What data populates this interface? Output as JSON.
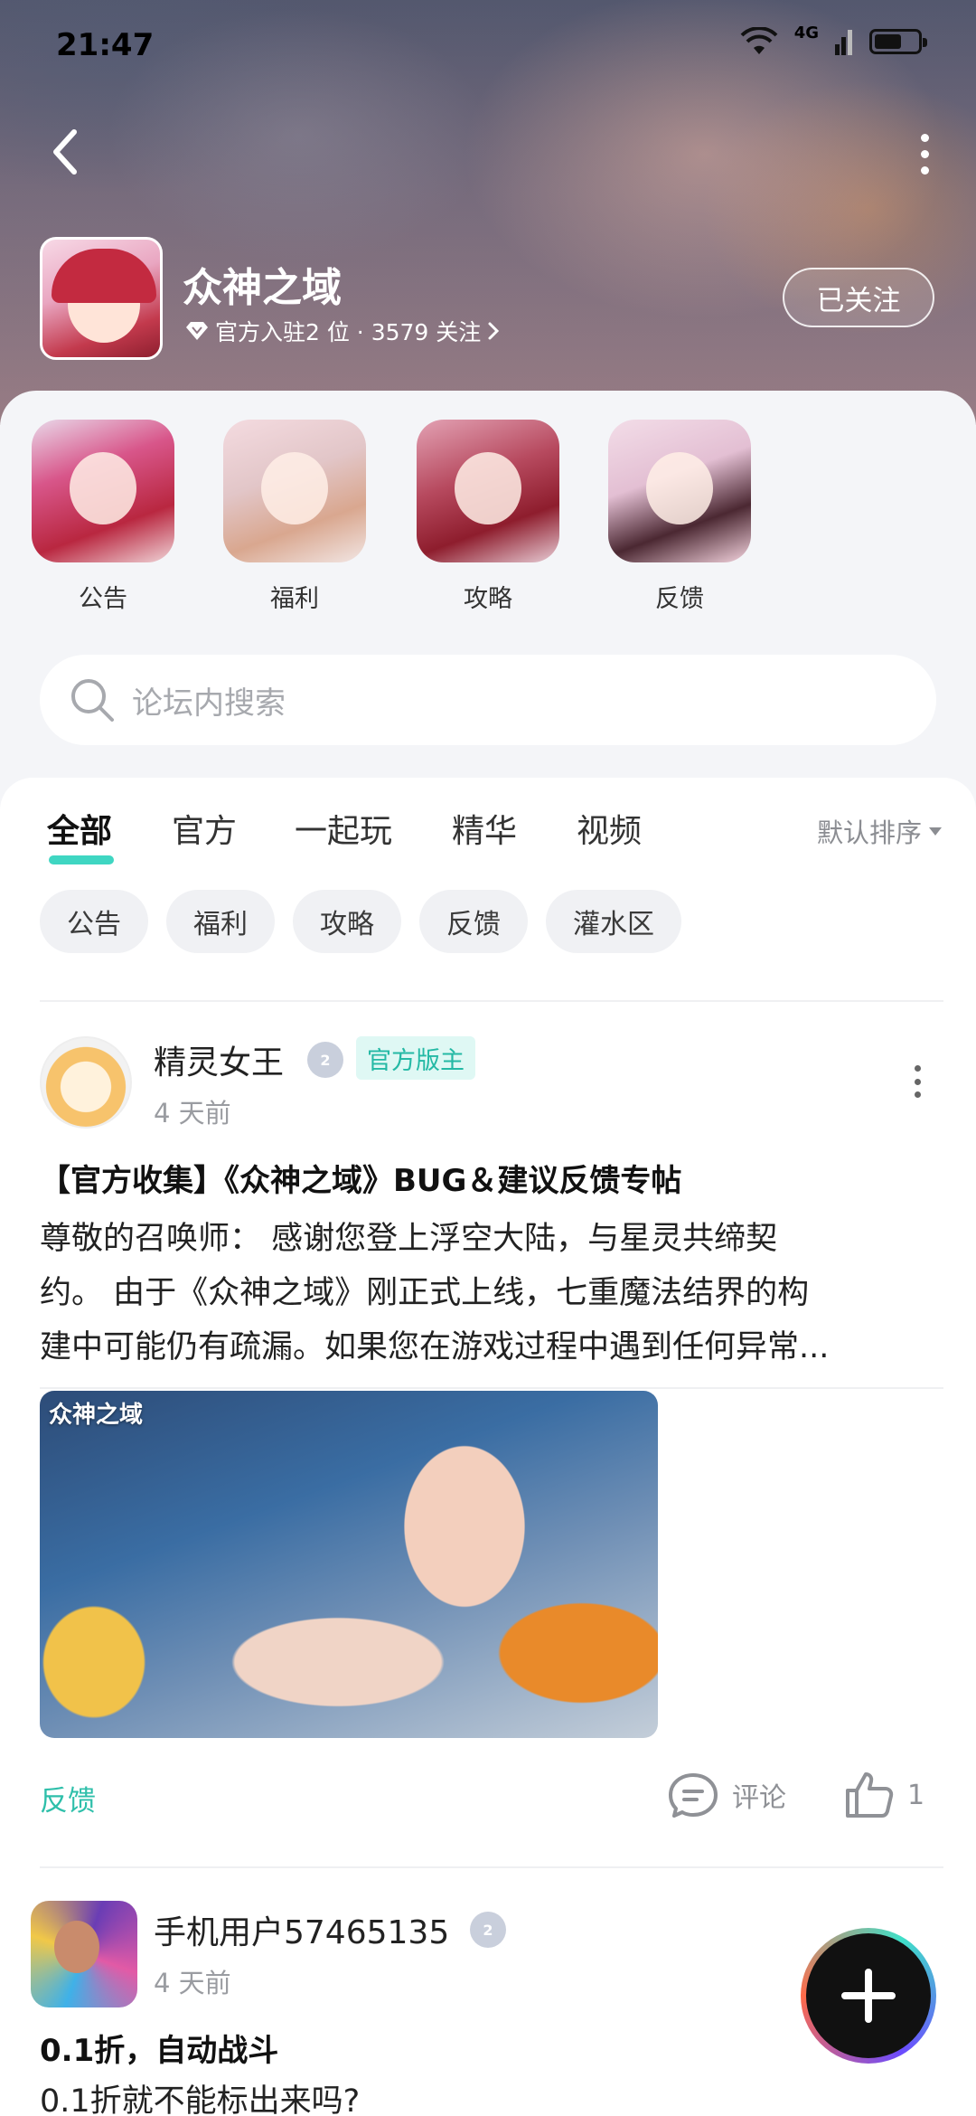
{
  "status_bar": {
    "time": "21:47",
    "network": "4G"
  },
  "header": {
    "forum_name": "众神之域",
    "meta": "官方入驻2 位 · 3579 关注",
    "follow_label": "已关注"
  },
  "shortcuts": [
    {
      "label": "公告"
    },
    {
      "label": "福利"
    },
    {
      "label": "攻略"
    },
    {
      "label": "反馈"
    }
  ],
  "search": {
    "placeholder": "论坛内搜索"
  },
  "tabs": [
    {
      "label": "全部",
      "active": true
    },
    {
      "label": "官方"
    },
    {
      "label": "一起玩"
    },
    {
      "label": "精华"
    },
    {
      "label": "视频"
    }
  ],
  "sort": {
    "label": "默认排序"
  },
  "chips": [
    "公告",
    "福利",
    "攻略",
    "反馈",
    "灌水区"
  ],
  "posts": [
    {
      "author": "精灵女王",
      "level": "2",
      "role": "官方版主",
      "time": "4 天前",
      "title": "【官方收集】《众神之域》BUG＆建议反馈专帖",
      "body_lines": [
        "尊敬的召唤师： 感谢您登上浮空大陆，与星灵共缔契",
        "约。 由于《众神之域》刚正式上线，七重魔法结界的构",
        "建中可能仍有疏漏。如果您在游戏过程中遇到任何异常..."
      ],
      "image_logo": "众神之域",
      "tag": "反馈",
      "comment_label": "评论",
      "like_count": "1"
    },
    {
      "author": "手机用户57465135",
      "level": "2",
      "time": "4 天前",
      "title": "0.1折，自动战斗",
      "body_lines": [
        "0.1折就不能标出来吗?"
      ]
    }
  ],
  "colors": {
    "accent": "#3fd6c2",
    "tag": "#2ebfaa",
    "role_bg": "#dff8f4"
  }
}
